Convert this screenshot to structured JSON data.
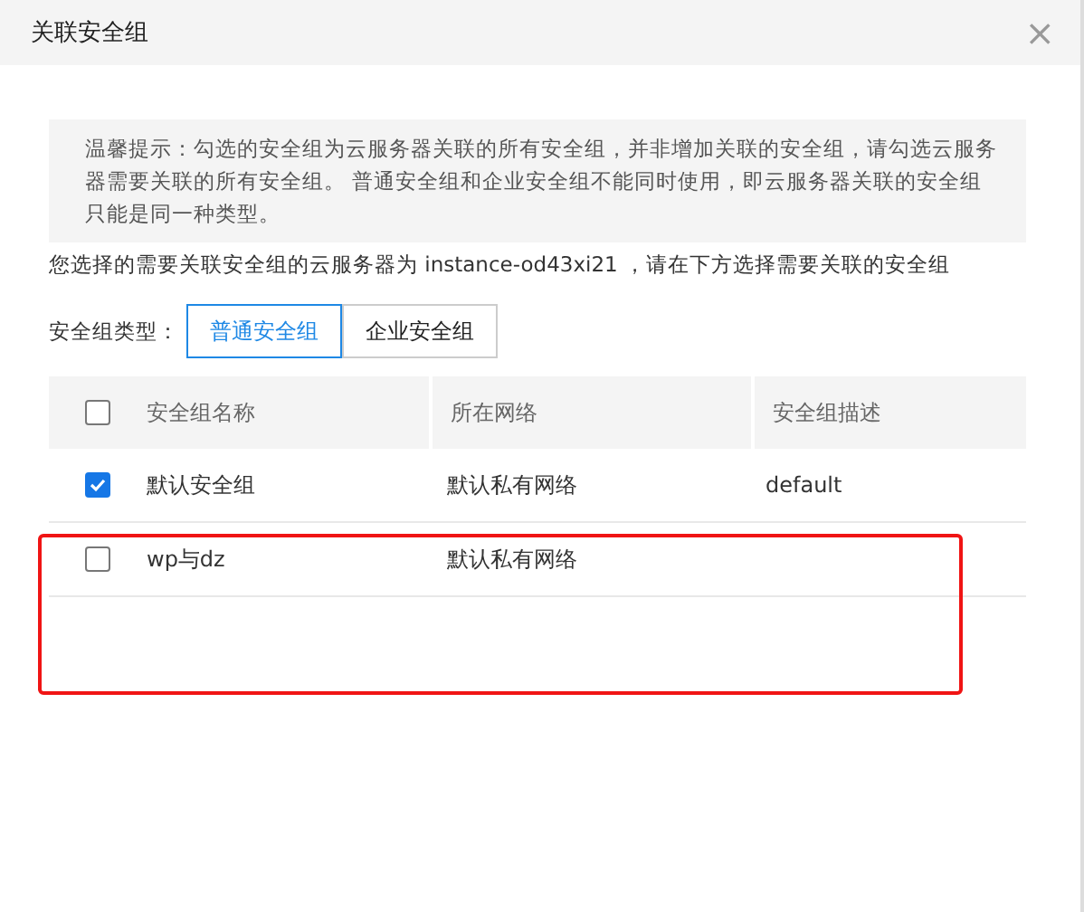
{
  "dialog": {
    "title": "关联安全组",
    "close": "×"
  },
  "tip": "温馨提示：勾选的安全组为云服务器关联的所有安全组，并非增加关联的安全组，请勾选云服务器需要关联的所有安全组。 普通安全组和企业安全组不能同时使用，即云服务器关联的安全组只能是同一种类型。",
  "instruction": "您选择的需要关联安全组的云服务器为 instance-od43xi21 ，请在下方选择需要关联的安全组",
  "type_label": "安全组类型：",
  "type_tabs": [
    {
      "label": "普通安全组",
      "selected": true
    },
    {
      "label": "企业安全组",
      "selected": false
    }
  ],
  "table": {
    "select_all_checked": false,
    "columns": [
      "安全组名称",
      "所在网络",
      "安全组描述"
    ],
    "rows": [
      {
        "checked": true,
        "cells": [
          "默认安全组",
          "默认私有网络",
          "default"
        ]
      },
      {
        "checked": false,
        "cells": [
          "wp与dz",
          "默认私有网络",
          ""
        ]
      }
    ]
  }
}
